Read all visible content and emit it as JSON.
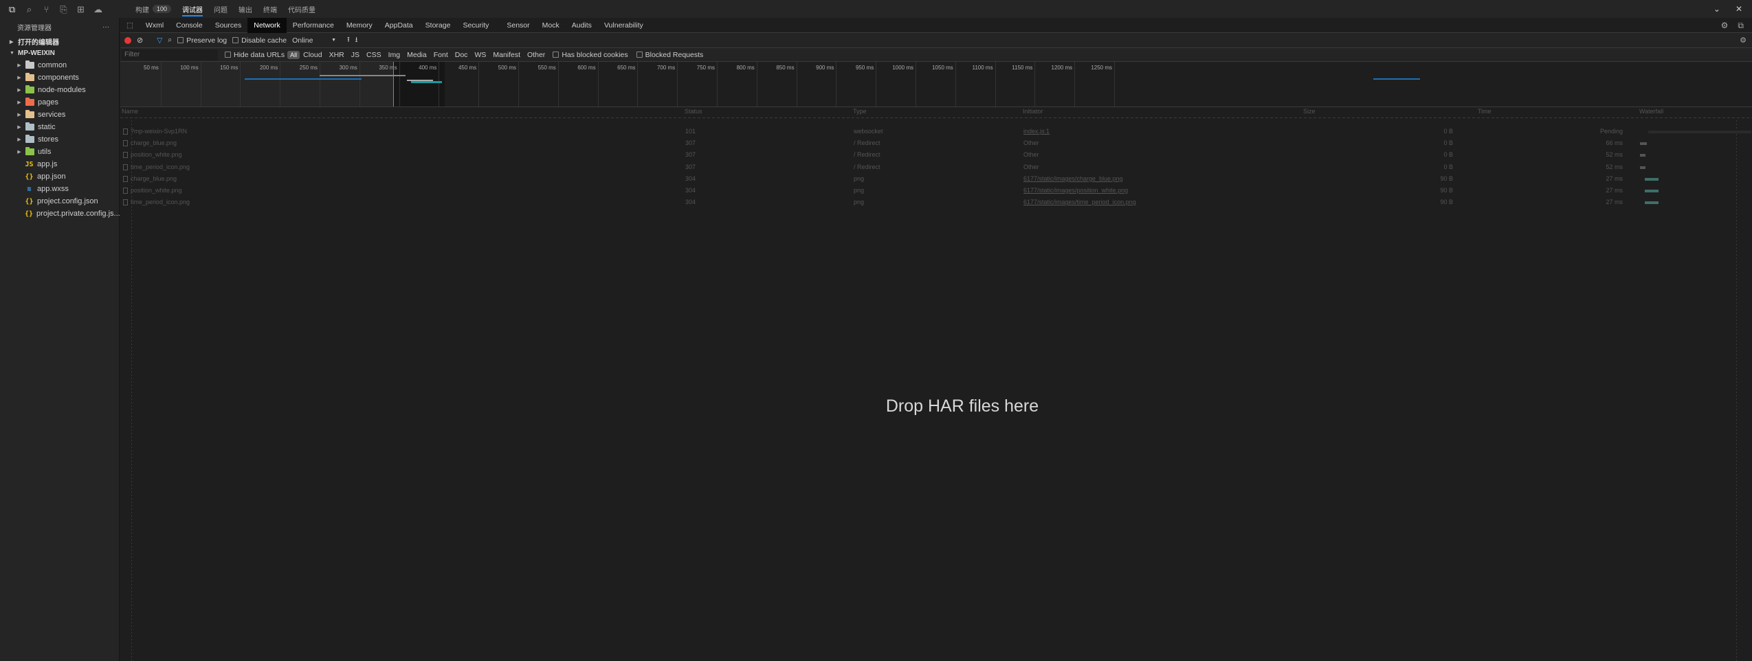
{
  "activity": {
    "icons": [
      "files-icon",
      "search-icon",
      "git-icon",
      "debug-icon",
      "extensions-icon",
      "cloud-icon"
    ]
  },
  "top_tabs": [
    {
      "label": "构建",
      "badge": "100"
    },
    {
      "label": "调试器",
      "active": true
    },
    {
      "label": "问题"
    },
    {
      "label": "输出"
    },
    {
      "label": "终端"
    },
    {
      "label": "代码质量"
    }
  ],
  "sidebar": {
    "title": "资源管理器",
    "open_editors": "打开的编辑器",
    "project": "MP-WEIXIN",
    "items": [
      {
        "label": "common",
        "type": "folder",
        "color": "#c8c8c8"
      },
      {
        "label": "components",
        "type": "folder",
        "color": "#e2c08d"
      },
      {
        "label": "node-modules",
        "type": "folder",
        "color": "#8bc34a"
      },
      {
        "label": "pages",
        "type": "folder",
        "color": "#ef6c4a"
      },
      {
        "label": "services",
        "type": "folder",
        "color": "#e2c08d"
      },
      {
        "label": "static",
        "type": "folder",
        "color": "#b0bec5"
      },
      {
        "label": "stores",
        "type": "folder",
        "color": "#b0bec5"
      },
      {
        "label": "utils",
        "type": "folder",
        "color": "#8bc34a"
      },
      {
        "label": "app.js",
        "type": "file",
        "icon": "JS",
        "color": "#f1c40f"
      },
      {
        "label": "app.json",
        "type": "file",
        "icon": "{}",
        "color": "#f1c40f"
      },
      {
        "label": "app.wxss",
        "type": "file",
        "icon": "≋",
        "color": "#42a5f5"
      },
      {
        "label": "project.config.json",
        "type": "file",
        "icon": "{}",
        "color": "#f1c40f"
      },
      {
        "label": "project.private.config.js...",
        "type": "file",
        "icon": "{}",
        "color": "#f1c40f"
      }
    ]
  },
  "devtools_tabs": [
    "Wxml",
    "Console",
    "Sources",
    "Network",
    "Performance",
    "Memory",
    "AppData",
    "Storage",
    "Security",
    "Sensor",
    "Mock",
    "Audits",
    "Vulnerability"
  ],
  "devtools_active": "Network",
  "toolbar": {
    "preserve_log": "Preserve log",
    "disable_cache": "Disable cache",
    "throttle": "Online"
  },
  "filterbar": {
    "placeholder": "Filter",
    "hide_data_urls": "Hide data URLs",
    "types": [
      "All",
      "Cloud",
      "XHR",
      "JS",
      "CSS",
      "Img",
      "Media",
      "Font",
      "Doc",
      "WS",
      "Manifest",
      "Other"
    ],
    "blocked_cookies": "Has blocked cookies",
    "blocked_requests": "Blocked Requests"
  },
  "overview": {
    "ticks": [
      "50 ms",
      "100 ms",
      "150 ms",
      "200 ms",
      "250 ms",
      "300 ms",
      "350 ms",
      "400 ms",
      "450 ms",
      "500 ms",
      "550 ms",
      "600 ms",
      "650 ms",
      "700 ms",
      "750 ms",
      "800 ms",
      "850 ms",
      "900 ms",
      "950 ms",
      "1000 ms",
      "1050 ms",
      "1100 ms",
      "1150 ms",
      "1200 ms",
      "1250 ms"
    ]
  },
  "grid": {
    "headers": {
      "name": "Name",
      "status": "Status",
      "type": "Type",
      "initiator": "Initiator",
      "size": "Size",
      "time": "Time",
      "waterfall": "Waterfall"
    },
    "rows": [
      {
        "name": "?mp-weixin-Svp1RN",
        "status": "101",
        "type": "websocket",
        "initiator": "index.js:1",
        "initiator_link": true,
        "size": "0 B",
        "time": "Pending"
      },
      {
        "name": "charge_blue.png",
        "status": "307",
        "type": "/ Redirect",
        "initiator": "Other",
        "initiator_link": false,
        "size": "0 B",
        "time": "66 ms"
      },
      {
        "name": "position_white.png",
        "status": "307",
        "type": "/ Redirect",
        "initiator": "Other",
        "initiator_link": false,
        "size": "0 B",
        "time": "52 ms"
      },
      {
        "name": "time_period_icon.png",
        "status": "307",
        "type": "/ Redirect",
        "initiator": "Other",
        "initiator_link": false,
        "size": "0 B",
        "time": "52 ms"
      },
      {
        "name": "charge_blue.png",
        "status": "304",
        "type": "png",
        "initiator": "6177/static/images/charge_blue.png",
        "initiator_link": true,
        "size": "90 B",
        "time": "27 ms"
      },
      {
        "name": "position_white.png",
        "status": "304",
        "type": "png",
        "initiator": "6177/static/images/position_white.png",
        "initiator_link": true,
        "size": "90 B",
        "time": "27 ms"
      },
      {
        "name": "time_period_icon.png",
        "status": "304",
        "type": "png",
        "initiator": "6177/static/images/time_period_icon.png",
        "initiator_link": true,
        "size": "90 B",
        "time": "27 ms"
      }
    ]
  },
  "drop_text": "Drop HAR files here"
}
